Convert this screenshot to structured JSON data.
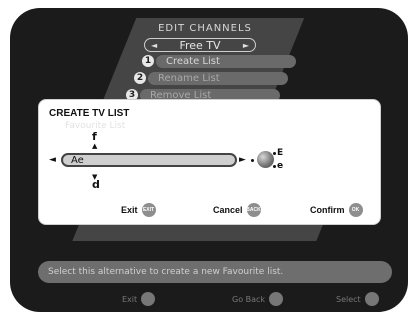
{
  "header": {
    "title": "EDIT CHANNELS",
    "selector_value": "Free TV"
  },
  "menu": [
    {
      "number": "1",
      "label": "Create List"
    },
    {
      "number": "2",
      "label": "Rename List"
    },
    {
      "number": "3",
      "label": "Remove List"
    }
  ],
  "dialog": {
    "title": "CREATE TV LIST",
    "ghost_text": "Favourite List",
    "input_value": "Ae",
    "char_above": "f",
    "char_below": "d",
    "case_upper": "E",
    "case_lower": "e",
    "buttons": [
      {
        "label": "Exit",
        "key": "EXIT"
      },
      {
        "label": "Cancel",
        "key": "BACK"
      },
      {
        "label": "Confirm",
        "key": "OK"
      }
    ]
  },
  "help_text": "Select this alternative to create a new Favourite list.",
  "bottom_buttons": [
    {
      "label": "Exit",
      "key": "EXIT"
    },
    {
      "label": "Go Back",
      "key": "BACK"
    },
    {
      "label": "Select",
      "key": "OK"
    }
  ]
}
